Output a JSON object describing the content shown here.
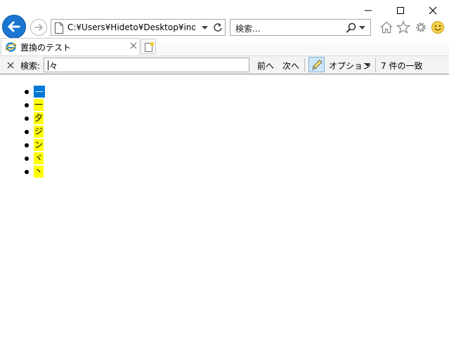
{
  "address_bar": {
    "url": "C:¥Users¥Hideto¥Desktop¥index.ht"
  },
  "search_box": {
    "placeholder": "検索..."
  },
  "tab": {
    "title": "置換のテスト"
  },
  "find_bar": {
    "label": "検索:",
    "query": "々",
    "prev_label": "前へ",
    "next_label": "次へ",
    "options_label": "オプション",
    "match_count": "7 件の一致"
  },
  "results": [
    {
      "text": "—",
      "active": true
    },
    {
      "text": "一",
      "active": false
    },
    {
      "text": "夕",
      "active": false
    },
    {
      "text": "ジ",
      "active": false
    },
    {
      "text": "ン",
      "active": false
    },
    {
      "text": "ヾ",
      "active": false
    },
    {
      "text": "丶",
      "active": false
    }
  ],
  "colors": {
    "back_button": "#1b76d2",
    "highlight": "#ffff00",
    "active_highlight": "#0078d7"
  },
  "icons": [
    "back-arrow-icon",
    "forward-arrow-icon",
    "home-icon",
    "favorites-star-icon",
    "settings-gear-icon",
    "smiley-feedback-icon",
    "ie-logo-icon",
    "magnifier-icon",
    "refresh-icon",
    "highlighter-icon"
  ]
}
